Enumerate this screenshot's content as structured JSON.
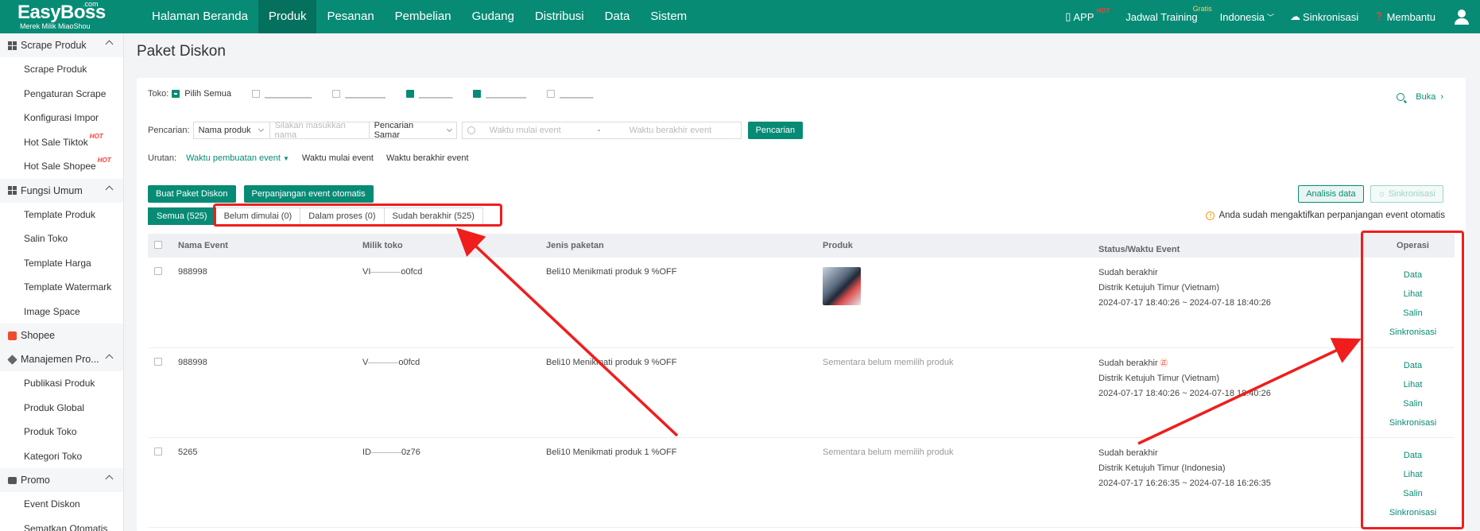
{
  "logo": {
    "brand": "EasyBoss",
    "com": ".com",
    "sub": "Merek Milik MiaoShou"
  },
  "nav": {
    "items": [
      "Halaman Beranda",
      "Produk",
      "Pesanan",
      "Pembelian",
      "Gudang",
      "Distribusi",
      "Data",
      "Sistem"
    ],
    "active_index": 1,
    "right": {
      "app": "APP",
      "app_badge": "HOT",
      "training": "Jadwal Training",
      "training_badge": "Gratis",
      "language": "Indonesia",
      "sync": "Sinkronisasi",
      "help": "Membantu"
    }
  },
  "sidebar": {
    "groups": [
      {
        "title": "Scrape Produk",
        "icon": "grid-icon",
        "items": [
          "Scrape Produk",
          "Pengaturan Scrape",
          "Konfigurasi Impor",
          "Hot Sale Tiktok",
          "Hot Sale Shopee"
        ],
        "hot_items": [
          3,
          4
        ]
      },
      {
        "title": "Fungsi Umum",
        "icon": "grid-icon",
        "items": [
          "Template Produk",
          "Salin Toko",
          "Template Harga",
          "Template Watermark",
          "Image Space"
        ]
      },
      {
        "title": "Shopee",
        "icon": "shopee-icon",
        "items": []
      },
      {
        "title": "Manajemen Pro...",
        "icon": "cube-icon",
        "items": [
          "Publikasi Produk",
          "Produk Global",
          "Produk Toko",
          "Kategori Toko"
        ]
      },
      {
        "title": "Promo",
        "icon": "promo-icon",
        "items": [
          "Event Diskon",
          "Sematkan Otomatis"
        ]
      }
    ],
    "hot_label": "HOT"
  },
  "page": {
    "title": "Paket Diskon"
  },
  "filters": {
    "toko_label": "Toko:",
    "select_all": "Pilih Semua",
    "buka": "Buka",
    "search_label": "Pencarian:",
    "search_field": "Nama produk",
    "search_placeholder": "Silakan masukkan nama",
    "search_mode": "Pencarian Samar",
    "start_placeholder": "Waktu mulai event",
    "date_sep": "-",
    "end_placeholder": "Waktu berakhir event",
    "search_button": "Pencarian",
    "sort_label": "Urutan:",
    "sort_options": [
      "Waktu pembuatan event",
      "Waktu mulai event",
      "Waktu berakhir event"
    ]
  },
  "actions": {
    "create": "Buat Paket Diskon",
    "auto_extend": "Perpanjangan event otomatis",
    "analysis": "Analisis data",
    "sync": "Sinkronisasi"
  },
  "tabs": [
    "Semua (525)",
    "Belum dimulai (0)",
    "Dalam proses (0)",
    "Sudah berakhir (525)"
  ],
  "notice": "Anda sudah mengaktifkan perpanjangan event otomatis",
  "table": {
    "headers": [
      "Nama Event",
      "Milik toko",
      "Jenis paketan",
      "Produk",
      "Status/Waktu Event",
      "Operasi"
    ],
    "rows": [
      {
        "name": "988998",
        "shop_a": "VI",
        "shop_b": "o0fcd",
        "package": "Beli10 Menikmati produk 9 %OFF",
        "product": "",
        "status": "Sudah berakhir",
        "zone": "Distrik Ketujuh Timur (Vietnam)",
        "time": "2024-07-17 18:40:26 ~ 2024-07-18 18:40:26"
      },
      {
        "name": "988998",
        "shop_a": "V",
        "shop_b": "o0fcd",
        "package": "Beli10 Menikmati produk 9 %OFF",
        "product": "Sementara belum memilih produk",
        "status": "Sudah berakhir",
        "zone": "Distrik Ketujuh Timur (Vietnam)",
        "time": "2024-07-17 18:40:26 ~ 2024-07-18 18:40:26"
      },
      {
        "name": "5265",
        "shop_a": "ID",
        "shop_b": "0z76",
        "package": "Beli10 Menikmati produk 1 %OFF",
        "product": "Sementara belum memilih produk",
        "status": "Sudah berakhir",
        "zone": "Distrik Ketujuh Timur (Indonesia)",
        "time": "2024-07-17 16:26:35 ~ 2024-07-18 16:26:35"
      }
    ],
    "ops": [
      "Data",
      "Lihat",
      "Salin",
      "Sinkronisasi"
    ]
  },
  "colors": {
    "primary": "#078b75",
    "annotation": "#f01d1d"
  }
}
